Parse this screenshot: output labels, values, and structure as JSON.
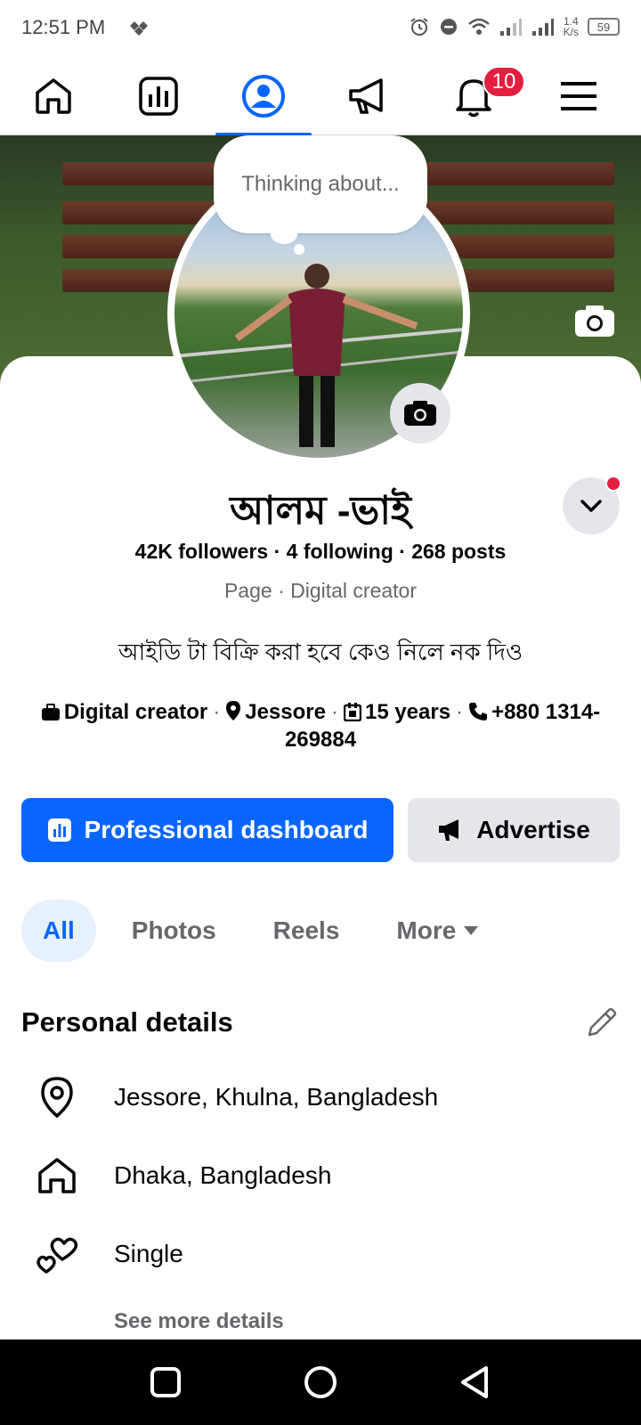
{
  "status_bar": {
    "time": "12:51 PM",
    "speed_value": "1.4",
    "speed_unit": "K/s",
    "battery": "59"
  },
  "nav": {
    "notification_count": "10"
  },
  "profile": {
    "thinking_prompt": "Thinking about...",
    "name": "আলম -ভাই",
    "stats": "42K followers · 4 following · 268 posts",
    "page_type": "Page · Digital creator",
    "bio": "আইডি টা বিক্রি করা হবে কেও নিলে নক দিও"
  },
  "intro": {
    "category": "Digital creator",
    "location": "Jessore",
    "years": "15 years",
    "phone": "+880 1314-269884"
  },
  "buttons": {
    "dashboard": "Professional dashboard",
    "advertise": "Advertise"
  },
  "tabs": [
    {
      "label": "All",
      "active": true
    },
    {
      "label": "Photos",
      "active": false
    },
    {
      "label": "Reels",
      "active": false
    },
    {
      "label": "More",
      "active": false
    }
  ],
  "personal_details": {
    "title": "Personal details",
    "items": [
      {
        "icon": "location-pin-icon",
        "text": "Jessore, Khulna, Bangladesh"
      },
      {
        "icon": "home-icon",
        "text": "Dhaka, Bangladesh"
      },
      {
        "icon": "hearts-icon",
        "text": "Single"
      }
    ],
    "see_more": "See more details"
  },
  "colors": {
    "brand_blue": "#0866ff",
    "badge_red": "#e41e3f",
    "secondary_text": "#65676b",
    "button_gray": "#e4e6eb"
  }
}
